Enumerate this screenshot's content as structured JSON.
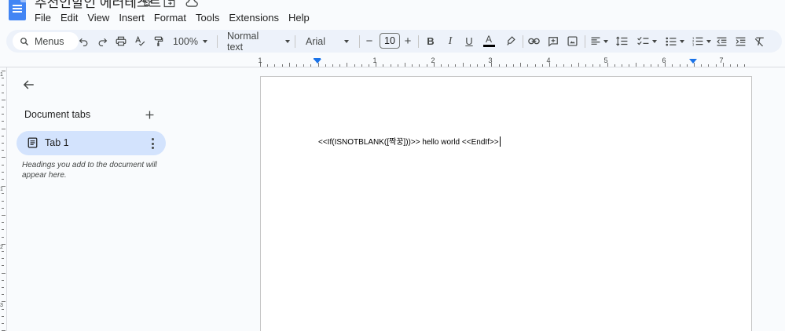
{
  "app": {
    "doc_title": "추천인할인 에러테스트"
  },
  "menu": {
    "items": [
      "File",
      "Edit",
      "View",
      "Insert",
      "Format",
      "Tools",
      "Extensions",
      "Help"
    ]
  },
  "toolbar": {
    "search_label": "Menus",
    "zoom": "100%",
    "style": "Normal text",
    "font": "Arial",
    "font_size": "10",
    "minus": "−",
    "plus": "+"
  },
  "ruler": {
    "labels": [
      "1",
      "1",
      "2",
      "3",
      "4",
      "5",
      "6",
      "7"
    ],
    "vlabels": [
      "1",
      "1",
      "2",
      "3"
    ]
  },
  "sidebar": {
    "section_title": "Document tabs",
    "tabs": [
      {
        "label": "Tab 1"
      }
    ],
    "hint": "Headings you add to the document will appear here."
  },
  "document": {
    "text": "<<If(ISNOTBLANK([짝꿍]))>> hello world <<EndIf>>"
  },
  "colors": {
    "accent": "#1a73e8",
    "toolbar_bg": "#edf2fa",
    "selected_tab": "#d3e3fd",
    "background": "#f9fbfd"
  }
}
